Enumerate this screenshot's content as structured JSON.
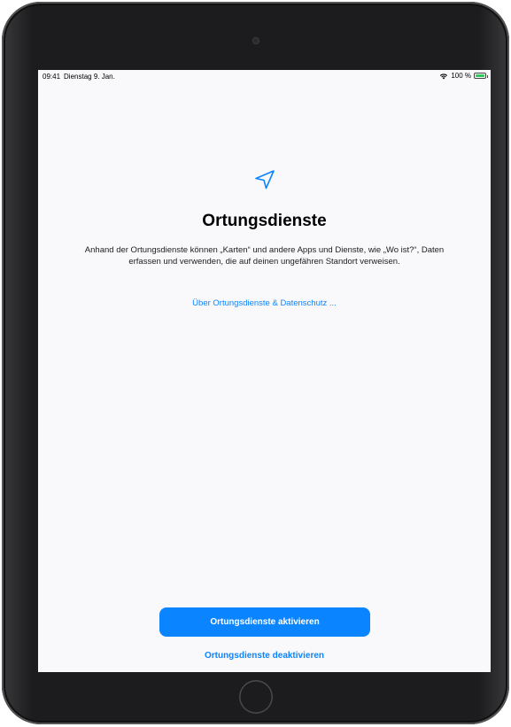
{
  "statusbar": {
    "time": "09:41",
    "date": "Dienstag 9. Jan.",
    "battery_percent": "100 %",
    "battery_level": 1.0
  },
  "icons": {
    "location": "location-arrow-icon",
    "wifi": "wifi-icon",
    "battery": "battery-icon"
  },
  "main": {
    "title": "Ortungsdienste",
    "description": "Anhand der Ortungsdienste können „Karten“ und andere Apps und Dienste, wie „Wo ist?“, Daten erfassen und verwenden, die auf deinen ungefähren Standort verweisen.",
    "privacy_link": "Über Ortungsdienste & Datenschutz ..."
  },
  "actions": {
    "enable_label": "Ortungsdienste aktivieren",
    "disable_label": "Ortungsdienste deaktivieren"
  },
  "colors": {
    "accent": "#0a84ff",
    "battery": "#34c759",
    "screen_background": "#f9f9fb",
    "device_frame": "#1c1c1e"
  }
}
